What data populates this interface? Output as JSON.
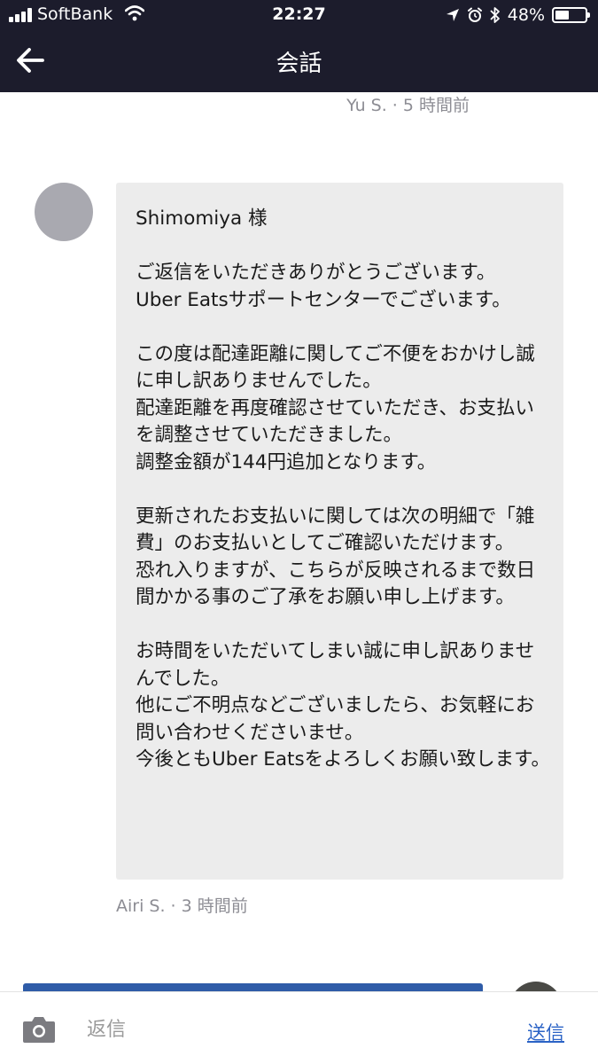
{
  "status_bar": {
    "carrier": "SoftBank",
    "time": "22:27",
    "battery": "48%",
    "battery_level": 0.48
  },
  "nav": {
    "title": "会話"
  },
  "conversation": {
    "previous_meta": "Yu S. · 5 時間前",
    "message": {
      "text": "Shimomiya 様\n\nご返信をいただきありがとうございます。\nUber Eatsサポートセンターでございます。\n\nこの度は配達距離に関してご不便をおかけし誠に申し訳ありませんでした。\n配達距離を再度確認させていただき、お支払いを調整させていただきました。\n調整金額が144円追加となります。\n\n更新されたお支払いに関しては次の明細で「雑費」のお支払いとしてご確認いただけます。\n恐れ入りますが、こちらが反映されるまで数日間かかる事のご了承をお願い申し上げます。\n\nお時間をいただいてしまい誠に申し訳ありませんでした。\n他にご不明点などございましたら、お気軽にお問い合わせくださいませ。\n今後ともUber Eatsをよろしくお願い致します。",
      "meta": "Airi S. · 3 時間前"
    }
  },
  "reply_bar": {
    "placeholder": "返信",
    "send_label": "送信"
  },
  "colors": {
    "header_bg": "#1c1c2c",
    "bubble_bg": "#ececec",
    "link_blue": "#2b63c6"
  }
}
